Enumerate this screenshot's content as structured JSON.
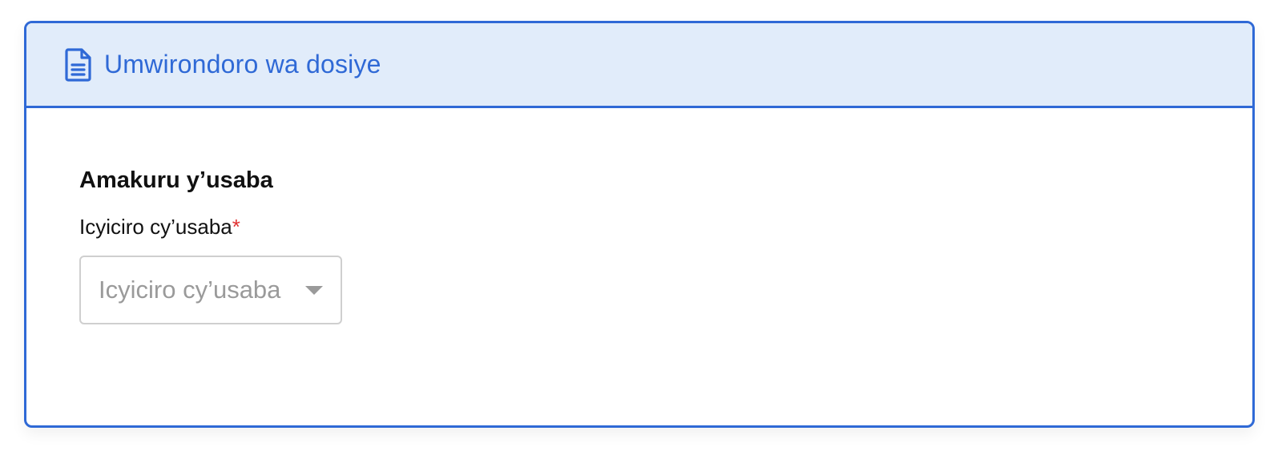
{
  "card": {
    "header": {
      "icon": "file-text-icon",
      "title": "Umwirondoro wa dosiye"
    },
    "section": {
      "title": "Amakuru y’usaba",
      "field": {
        "label": "Icyiciro cy’usaba",
        "required_marker": "*",
        "select": {
          "placeholder": "Icyiciro cy’usaba",
          "icon": "caret-down-icon"
        }
      }
    }
  },
  "colors": {
    "accent": "#2f69d6",
    "header_background": "#e1ecfa",
    "required": "#e03131",
    "placeholder": "#9a9a9a",
    "input_border": "#cfcfcf"
  }
}
